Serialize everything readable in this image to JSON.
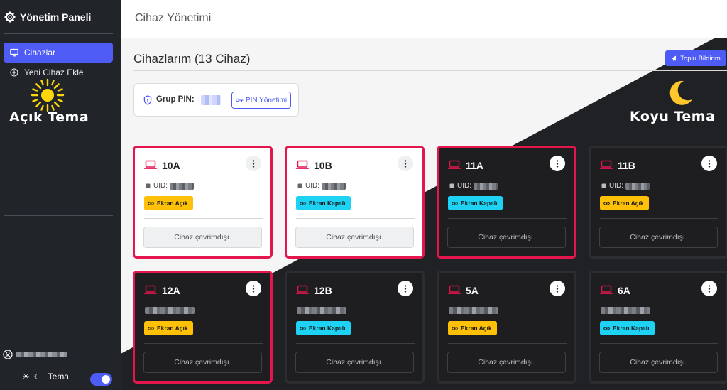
{
  "sidebar": {
    "brand": "Yönetim Paneli",
    "items": [
      {
        "label": "Cihazlar",
        "active": true,
        "icon": "monitor-icon"
      },
      {
        "label": "Yeni Cihaz Ekle",
        "active": false,
        "icon": "plus-circle-icon"
      }
    ],
    "theme_label": "Tema",
    "theme_toggle_on": true
  },
  "topbar": {
    "title": "Cihaz Yönetimi"
  },
  "main": {
    "heading": "Cihazlarım (13 Cihaz)",
    "bulk_button": "Toplu Bildirim",
    "pin": {
      "label": "Grup PIN:",
      "manage_button": "PIN Yönetimi"
    }
  },
  "annotations": {
    "light_theme": "Açık Tema",
    "dark_theme": "Koyu Tema"
  },
  "colors": {
    "accent": "#4e5cf5",
    "danger": "#e5164e",
    "warning": "#ffc107",
    "info": "#1ed2f4",
    "sun": "#ffd60a",
    "moon": "#ffc72c"
  },
  "devices": [
    {
      "name": "10A",
      "uid_label": "UID:",
      "status": "Ekran Açık",
      "status_type": "on",
      "action": "Cihaz çevrimdışı."
    },
    {
      "name": "10B",
      "uid_label": "UID:",
      "status": "Ekran Kapalı",
      "status_type": "off",
      "action": "Cihaz çevrimdışı."
    },
    {
      "name": "11A",
      "uid_label": "UID:",
      "status": "Ekran Kapalı",
      "status_type": "off",
      "action": "Cihaz çevrimdışı."
    },
    {
      "name": "11B",
      "uid_label": "UID:",
      "status": "Ekran Açık",
      "status_type": "on",
      "action": "Cihaz çevrimdışı."
    },
    {
      "name": "12A",
      "uid_label": "",
      "status": "Ekran Açık",
      "status_type": "on",
      "action": "Cihaz çevrimdışı."
    },
    {
      "name": "12B",
      "uid_label": "",
      "status": "Ekran Kapalı",
      "status_type": "off",
      "action": "Cihaz çevrimdışı."
    },
    {
      "name": "5A",
      "uid_label": "",
      "status": "Ekran Açık",
      "status_type": "on",
      "action": "Cihaz çevrimdışı."
    },
    {
      "name": "6A",
      "uid_label": "",
      "status": "Ekran Kapalı",
      "status_type": "off",
      "action": "Cihaz çevrimdışı."
    }
  ]
}
